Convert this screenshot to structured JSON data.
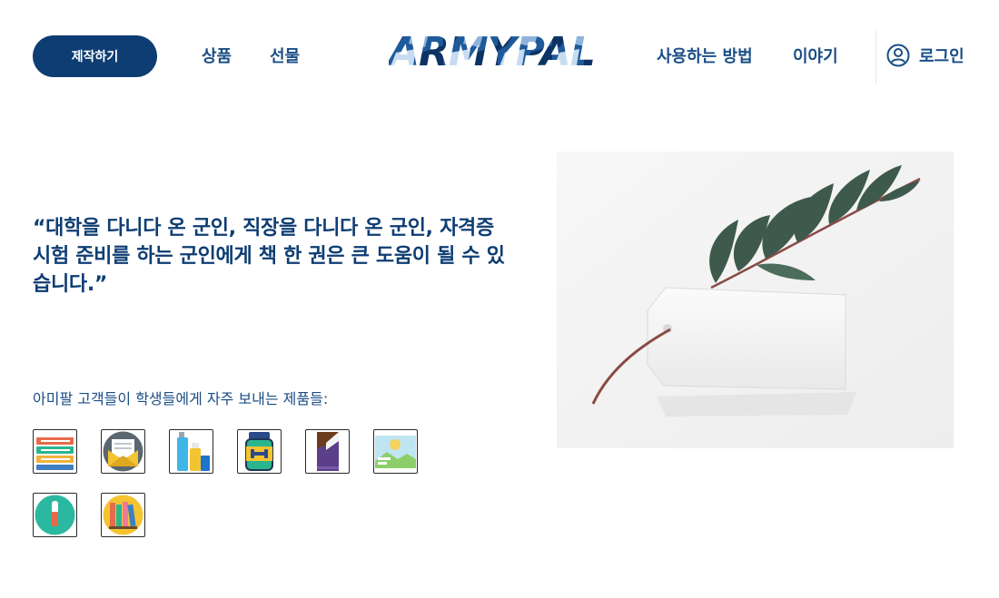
{
  "header": {
    "cta_label": "제작하기",
    "nav": [
      "상품",
      "선물",
      "사용하는 방법",
      "이야기"
    ],
    "logo_text": "ARMYPAL",
    "login_label": "로그인"
  },
  "main": {
    "quote_lines": [
      "“대학을 다니다 온 군인, 직장을 다니다 온 군인, 자격증",
      "시험 준비를 하는 군인에게 책 한 권은 큰 도움이 될 수 있",
      "습니다.”"
    ],
    "subtitle": "아미팔 고객들이 학생들에게 자주 보내는 제품들:",
    "products": [
      {
        "icon": "books-stack-icon"
      },
      {
        "icon": "letter-envelope-icon"
      },
      {
        "icon": "toiletries-icon"
      },
      {
        "icon": "supplement-jar-icon"
      },
      {
        "icon": "chocolate-bar-icon"
      },
      {
        "icon": "landscape-photo-icon"
      },
      {
        "icon": "lip-balm-icon"
      },
      {
        "icon": "bookshelf-icon"
      }
    ]
  },
  "colors": {
    "primary": "#0e3d73",
    "nav_text": "#1a4d86"
  }
}
